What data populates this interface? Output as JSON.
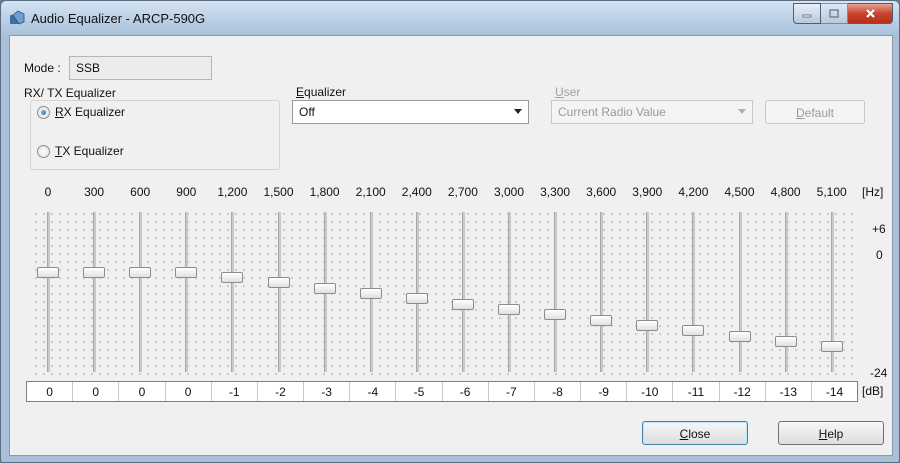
{
  "window": {
    "title": "Audio Equalizer - ARCP-590G"
  },
  "mode": {
    "label": "Mode :",
    "value": "SSB"
  },
  "rxtx_group": {
    "title": "RX/ TX Equalizer",
    "rx_label": "RX Equalizer",
    "rx_mnemonic": "R",
    "rx_rest": "X Equalizer",
    "tx_label": "TX Equalizer",
    "tx_mnemonic": "T",
    "tx_rest": "X Equalizer",
    "selected": "rx"
  },
  "equalizer": {
    "label": "Equalizer",
    "label_mnemonic": "E",
    "label_rest": "qualizer",
    "value": "Off"
  },
  "user": {
    "label": "User",
    "label_mnemonic": "U",
    "label_rest": "ser",
    "value": "Current Radio Value",
    "enabled": false
  },
  "buttons": {
    "default_label": "Default",
    "default_mnemonic": "D",
    "default_rest": "efault",
    "close_label": "Close",
    "close_mnemonic": "C",
    "close_rest": "lose",
    "help_label": "Help",
    "help_mnemonic": "H",
    "help_rest": "elp"
  },
  "units": {
    "hz": "[Hz]",
    "db": "[dB]"
  },
  "scale": {
    "top": "+6",
    "zero": "0",
    "bottom": "-24",
    "max_db": 6,
    "min_db": -24
  },
  "bands": [
    {
      "freq": "0",
      "db": 0
    },
    {
      "freq": "300",
      "db": 0
    },
    {
      "freq": "600",
      "db": 0
    },
    {
      "freq": "900",
      "db": 0
    },
    {
      "freq": "1,200",
      "db": -1
    },
    {
      "freq": "1,500",
      "db": -2
    },
    {
      "freq": "1,800",
      "db": -3
    },
    {
      "freq": "2,100",
      "db": -4
    },
    {
      "freq": "2,400",
      "db": -5
    },
    {
      "freq": "2,700",
      "db": -6
    },
    {
      "freq": "3,000",
      "db": -7
    },
    {
      "freq": "3,300",
      "db": -8
    },
    {
      "freq": "3,600",
      "db": -9
    },
    {
      "freq": "3,900",
      "db": -10
    },
    {
      "freq": "4,200",
      "db": -11
    },
    {
      "freq": "4,500",
      "db": -12
    },
    {
      "freq": "4,800",
      "db": -13
    },
    {
      "freq": "5,100",
      "db": -14
    }
  ]
}
